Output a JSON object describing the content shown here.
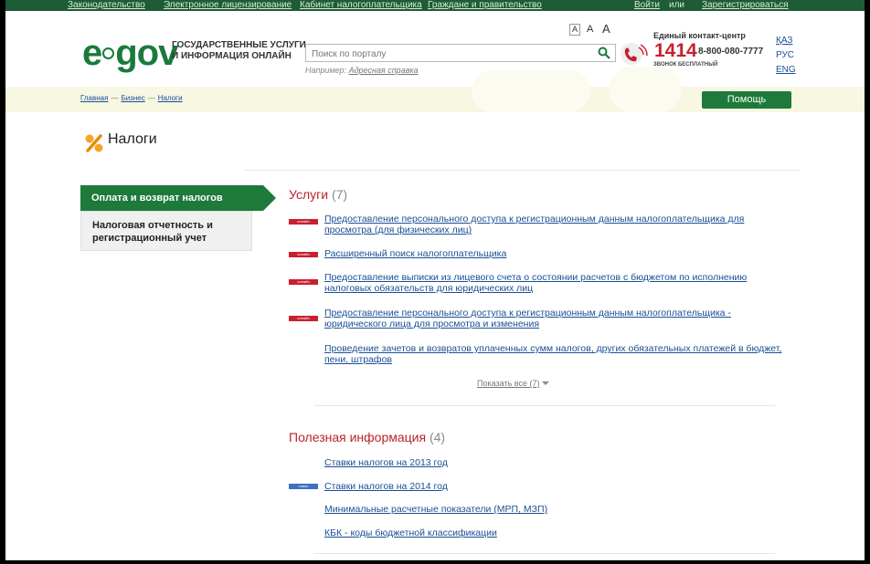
{
  "top_nav": [
    {
      "label": "Законодательство"
    },
    {
      "label": "Электронное лицензирование"
    },
    {
      "label": "Кабинет налогоплательщика"
    },
    {
      "label": "Граждане и правительство"
    }
  ],
  "auth": {
    "login": "Войти",
    "or": "или",
    "register": "Зарегистрироваться"
  },
  "logo": {
    "e": "e",
    "gov": "gov",
    "tagline_line1": "ГОСУДАРСТВЕННЫЕ УСЛУГИ",
    "tagline_line2": "И ИНФОРМАЦИЯ ОНЛАЙН"
  },
  "search": {
    "placeholder": "Поиск по порталу",
    "example_prefix": "Например:",
    "example_link": "Адресная справка"
  },
  "font_size": {
    "small": "A",
    "medium": "A",
    "large": "A"
  },
  "contact": {
    "title": "Единый контакт-центр",
    "short_number": "1414",
    "long_number": "8-800-080-7777",
    "note": "ЗВОНОК БЕСПЛАТНЫЙ"
  },
  "languages": [
    {
      "label": "ҚАЗ"
    },
    {
      "label": "РУС"
    },
    {
      "label": "ENG"
    }
  ],
  "breadcrumb": [
    {
      "label": "Главная"
    },
    {
      "label": "Бизнес"
    },
    {
      "label": "Налоги"
    }
  ],
  "breadcrumb_sep": "—",
  "help_button": "Помощь",
  "page_title": "Налоги",
  "sidebar": [
    {
      "label": "Оплата и возврат налогов",
      "active": true
    },
    {
      "label": "Налоговая отчетность и регистрационный учет",
      "active": false
    }
  ],
  "services": {
    "title": "Услуги",
    "count": "(7)",
    "items": [
      {
        "badge": "онлайн",
        "label": "Предоставление персонального доступа к регистрационным данным налогоплательщика для просмотра (для физических лиц)"
      },
      {
        "badge": "онлайн",
        "label": "Расширенный поиск налогоплательщика"
      },
      {
        "badge": "онлайн",
        "label": "Предоставление выписки из лицевого счета о состоянии расчетов с бюджетом по исполнению налоговых обязательств для юридических лиц"
      },
      {
        "badge": "онлайн",
        "label": "Предоставление персонального доступа к регистрационным данным налогоплательщика - юридического лица для просмотра и изменения"
      },
      {
        "badge": "",
        "label": "Проведение зачетов и возвратов уплаченных сумм налогов, других обязательных платежей в бюджет, пени, штрафов"
      }
    ],
    "show_all": "Показать все (7)"
  },
  "useful": {
    "title": "Полезная информация",
    "count": "(4)",
    "items": [
      {
        "badge": "",
        "label": "Ставки налогов на 2013 год"
      },
      {
        "badge": "новое",
        "label": "Ставки налогов на 2014 год"
      },
      {
        "badge": "",
        "label": "Минимальные расчетные показатели (МРП, МЗП)"
      },
      {
        "badge": "",
        "label": "КБК - коды бюджетной классификации"
      }
    ]
  },
  "colors": {
    "brand_green": "#1a7a3c",
    "accent_red": "#b8232b",
    "link_blue": "#1a4f95",
    "badge_blue": "#3b6fc2"
  }
}
